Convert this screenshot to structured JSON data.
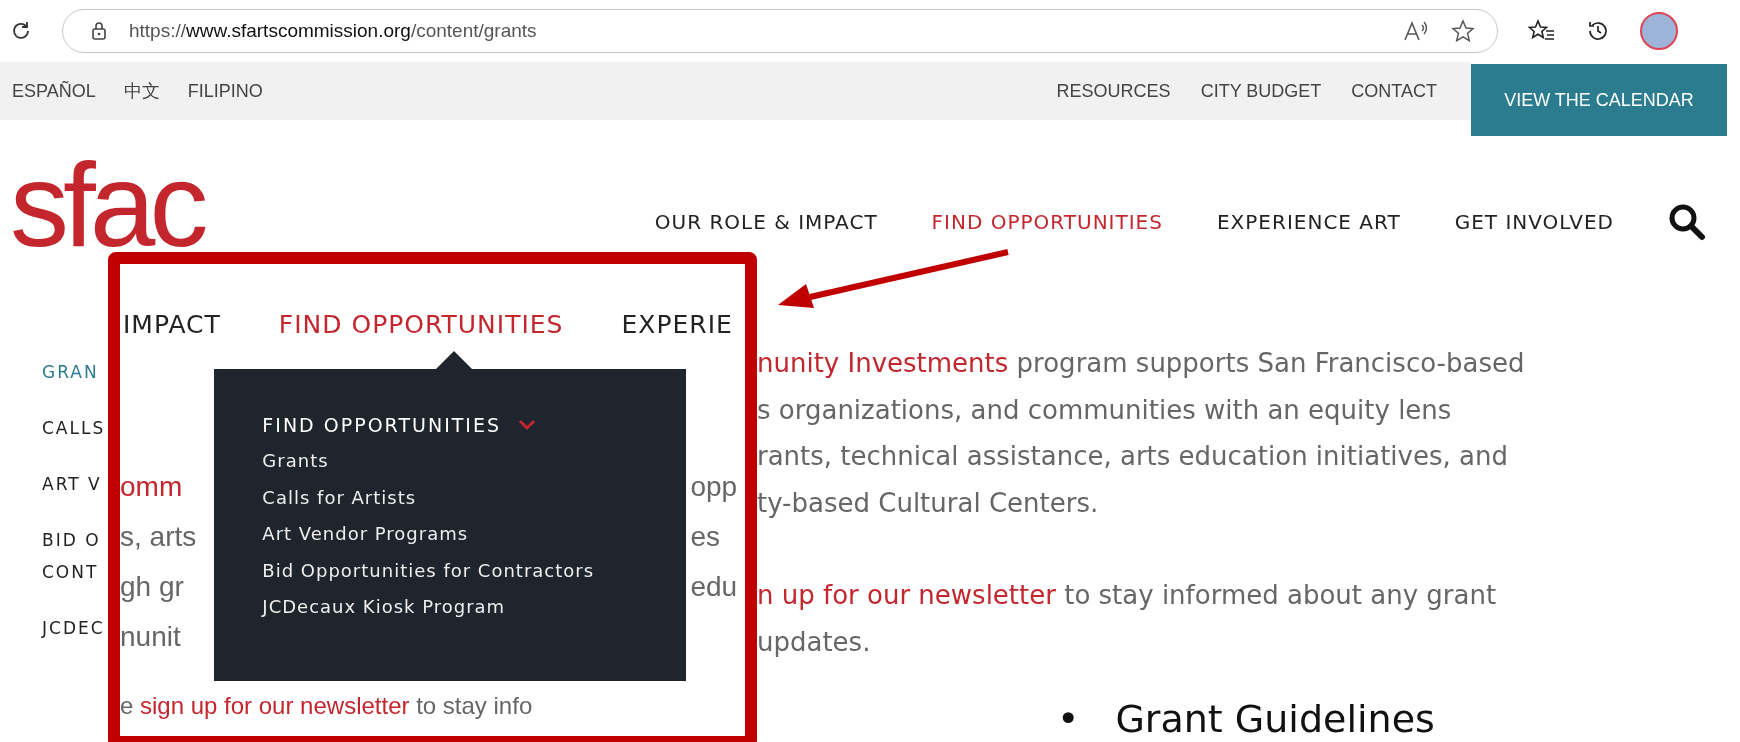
{
  "browser": {
    "url_scheme": "https://",
    "url_host": "www.sfartscommission.org",
    "url_path": "/content/grants"
  },
  "utility_bar": {
    "languages": [
      "ESPAÑOL",
      "中文",
      "FILIPINO"
    ],
    "links": [
      "RESOURCES",
      "CITY BUDGET",
      "CONTACT"
    ],
    "calendar_button": "VIEW THE CALENDAR"
  },
  "header": {
    "logo": "sfac",
    "nav": [
      {
        "label": "OUR ROLE & IMPACT",
        "selected": false
      },
      {
        "label": "FIND OPPORTUNITIES",
        "selected": true
      },
      {
        "label": "EXPERIENCE ART",
        "selected": false
      },
      {
        "label": "GET INVOLVED",
        "selected": false
      }
    ]
  },
  "sidebar": {
    "items": [
      {
        "lines": [
          "GRAN"
        ],
        "selected": true
      },
      {
        "lines": [
          "CALLS"
        ],
        "selected": false
      },
      {
        "lines": [
          "ART V"
        ],
        "selected": false
      },
      {
        "lines": [
          "BID O",
          "CONT"
        ],
        "selected": false
      },
      {
        "lines": [
          "JCDEC"
        ],
        "selected": false
      }
    ]
  },
  "content": {
    "paragraphs": [
      [
        [
          {
            "kind": "link",
            "text": "nunity Investments"
          },
          {
            "kind": "text",
            "text": " program supports San Francisco-based"
          }
        ],
        [
          {
            "kind": "text",
            "text": "s organizations, and communities with an equity lens"
          }
        ],
        [
          {
            "kind": "text",
            "text": "rants, technical assistance, arts education initiatives, and"
          }
        ],
        [
          {
            "kind": "text",
            "text": "ty-based Cultural Centers."
          }
        ]
      ],
      [
        [
          {
            "kind": "link",
            "text": "n up for our newsletter"
          },
          {
            "kind": "text",
            "text": " to stay informed about any grant"
          }
        ],
        [
          {
            "kind": "text",
            "text": "updates."
          }
        ]
      ]
    ],
    "bullets": [
      {
        "marker": "•",
        "text": "Grant Guidelines"
      }
    ]
  },
  "callout": {
    "nav": [
      {
        "label": "IMPACT",
        "selected": false
      },
      {
        "label": "FIND OPPORTUNITIES",
        "selected": true
      },
      {
        "label": "EXPERIE",
        "selected": false
      }
    ],
    "left_fragments": [
      {
        "kind": "link",
        "text": "omm"
      },
      {
        "kind": "text",
        "text": "s, arts"
      },
      {
        "kind": "text",
        "text": "gh gr"
      },
      {
        "kind": "text",
        "text": "nunit"
      }
    ],
    "right_fragments": [
      "opp",
      "es",
      "edu"
    ],
    "dropdown": {
      "heading": "FIND OPPORTUNITIES",
      "items": [
        "Grants",
        "Calls for Artists",
        "Art Vendor Programs",
        "Bid Opportunities for Contractors",
        "JCDecaux Kiosk Program"
      ]
    },
    "bottom_line": [
      {
        "kind": "text",
        "text": "e "
      },
      {
        "kind": "link",
        "text": "sign up for our newsletter"
      },
      {
        "kind": "text",
        "text": " to stay info"
      }
    ]
  }
}
